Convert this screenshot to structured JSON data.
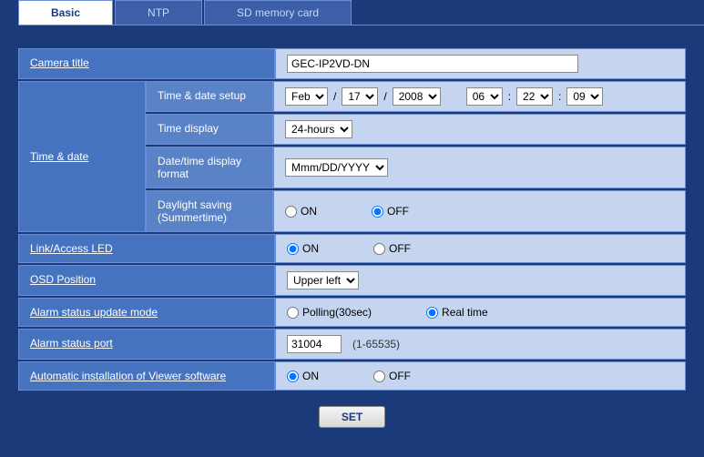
{
  "tabs": {
    "basic": "Basic",
    "ntp": "NTP",
    "sd": "SD memory card"
  },
  "labels": {
    "camera_title": "Camera title",
    "time_date": "Time & date",
    "time_date_setup": "Time & date setup",
    "time_display": "Time display",
    "date_format": "Date/time display format",
    "daylight": "Daylight saving (Summertime)",
    "link_led": "Link/Access LED",
    "osd_position": "OSD Position",
    "alarm_mode": "Alarm status update mode",
    "alarm_port": "Alarm status port",
    "auto_install": "Automatic installation of Viewer software"
  },
  "values": {
    "camera_title": "GEC-IP2VD-DN",
    "month": "Feb",
    "day": "17",
    "year": "2008",
    "hour": "06",
    "min": "22",
    "sec": "09",
    "time_display": "24-hours",
    "date_format": "Mmm/DD/YYYY",
    "osd_position": "Upper left",
    "alarm_port": "31004"
  },
  "opts": {
    "on": "ON",
    "off": "OFF",
    "polling": "Polling(30sec)",
    "realtime": "Real time",
    "port_hint": "(1-65535)",
    "set": "SET"
  }
}
